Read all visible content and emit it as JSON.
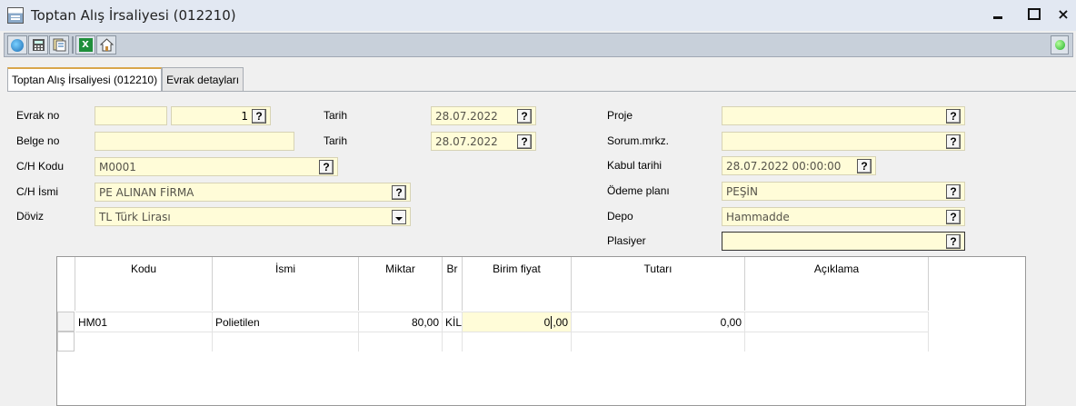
{
  "window": {
    "title": "Toptan Alış İrsaliyesi (012210)",
    "close_glyph": "×"
  },
  "toolbar": {
    "icons": [
      "globe-icon",
      "calculator-icon",
      "documents-icon",
      "excel-icon",
      "home-icon"
    ],
    "excel_glyph": "X"
  },
  "tabs": [
    {
      "label": "Toptan Alış İrsaliyesi (012210)"
    },
    {
      "label": "Evrak detayları"
    }
  ],
  "form": {
    "evrak_no": {
      "label": "Evrak no",
      "series": "",
      "number": "1"
    },
    "belge_no": {
      "label": "Belge no",
      "value": ""
    },
    "ch_kodu": {
      "label": "C/H Kodu",
      "value": "M0001"
    },
    "ch_ismi": {
      "label": "C/H İsmi",
      "value": "PE ALINAN FİRMA"
    },
    "doviz": {
      "label": "Döviz",
      "value": "TL  Türk Lirası"
    },
    "tarih1": {
      "label": "Tarih",
      "value": "28.07.2022"
    },
    "tarih2": {
      "label": "Tarih",
      "value": "28.07.2022"
    },
    "proje": {
      "label": "Proje",
      "value": ""
    },
    "sorum": {
      "label": "Sorum.mrkz.",
      "value": ""
    },
    "kabul": {
      "label": "Kabul tarihi",
      "value": "28.07.2022 00:00:00"
    },
    "odeme": {
      "label": "Ödeme planı",
      "value": "PEŞİN"
    },
    "depo": {
      "label": "Depo",
      "value": "Hammadde"
    },
    "plasiyer": {
      "label": "Plasiyer",
      "value": ""
    },
    "help_glyph": "?"
  },
  "grid": {
    "columns": [
      "Kodu",
      "İsmi",
      "Miktar",
      "Br",
      "Birim fiyat",
      "Tutarı",
      "Açıklama"
    ],
    "rows": [
      {
        "kodu": "HM01",
        "ismi": "Polietilen",
        "miktar": "80,00",
        "br": "KİL",
        "birim_fiyat_a": "0",
        "birim_fiyat_b": ",00",
        "tutar": "0,00",
        "aciklama": ""
      }
    ]
  },
  "colors": {
    "field_bg": "#fffcd8",
    "title_bar": "#e2e8f2",
    "toolbar": "#c8d0da",
    "status_green": "#22b02a"
  }
}
